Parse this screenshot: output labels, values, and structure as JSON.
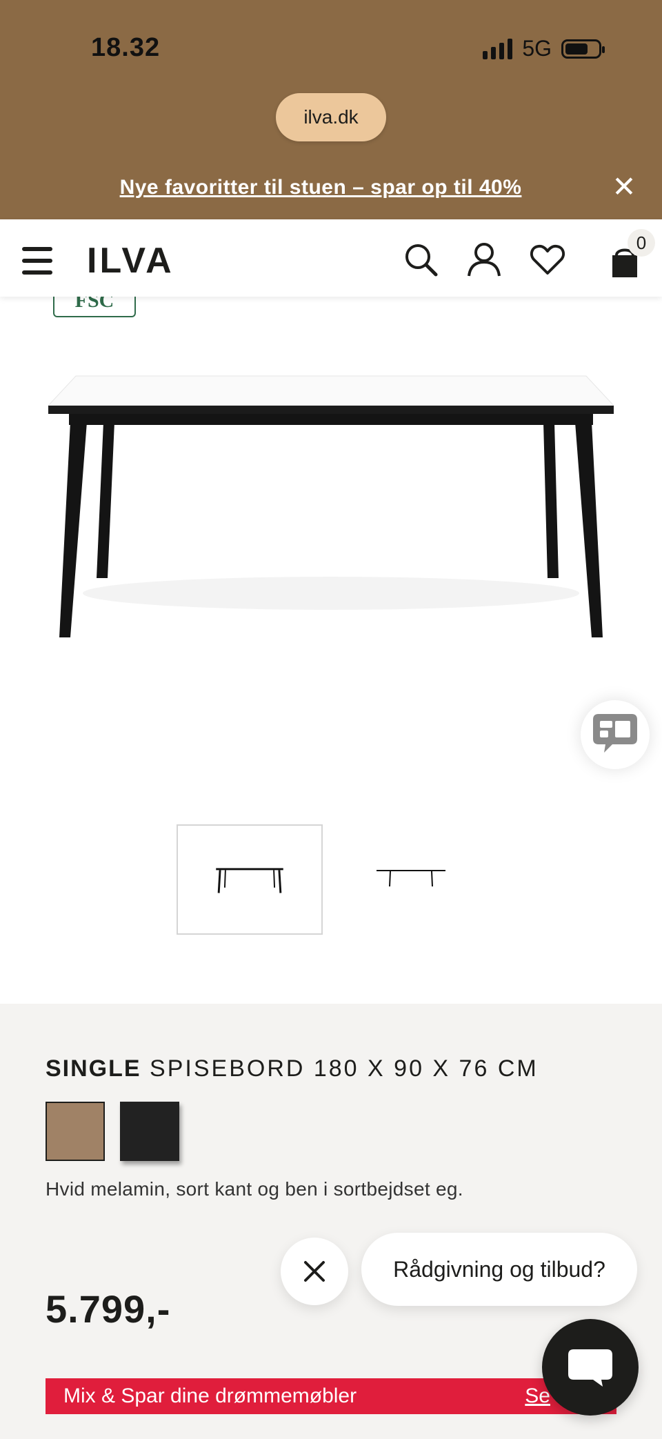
{
  "status_bar": {
    "time": "18.32",
    "network": "5G"
  },
  "browser": {
    "url": "ilva.dk"
  },
  "promo": {
    "text": "Nye favoritter til stuen – spar op til 40%",
    "close": "✕"
  },
  "nav": {
    "logo": "ILVA",
    "cart_count": "0"
  },
  "badges": {
    "fsc": "FSC"
  },
  "product": {
    "brand": "SINGLE",
    "name": "SPISEBORD 180 X 90 X 76 CM",
    "description": "Hvid melamin, sort kant og ben i sortbejdset eg.",
    "price": "5.799,-",
    "swatches": [
      {
        "name": "oak",
        "color": "#a08266"
      },
      {
        "name": "black",
        "color": "#222222"
      }
    ]
  },
  "chat": {
    "prompt": "Rådgivning og tilbud?"
  },
  "banner": {
    "text": "Mix & Spar dine drømmemøbler",
    "link": "Se"
  },
  "colors": {
    "header": "#8b6a45",
    "pill": "#ecc79b",
    "banner": "#e01e3c",
    "panel": "#f4f3f1"
  }
}
